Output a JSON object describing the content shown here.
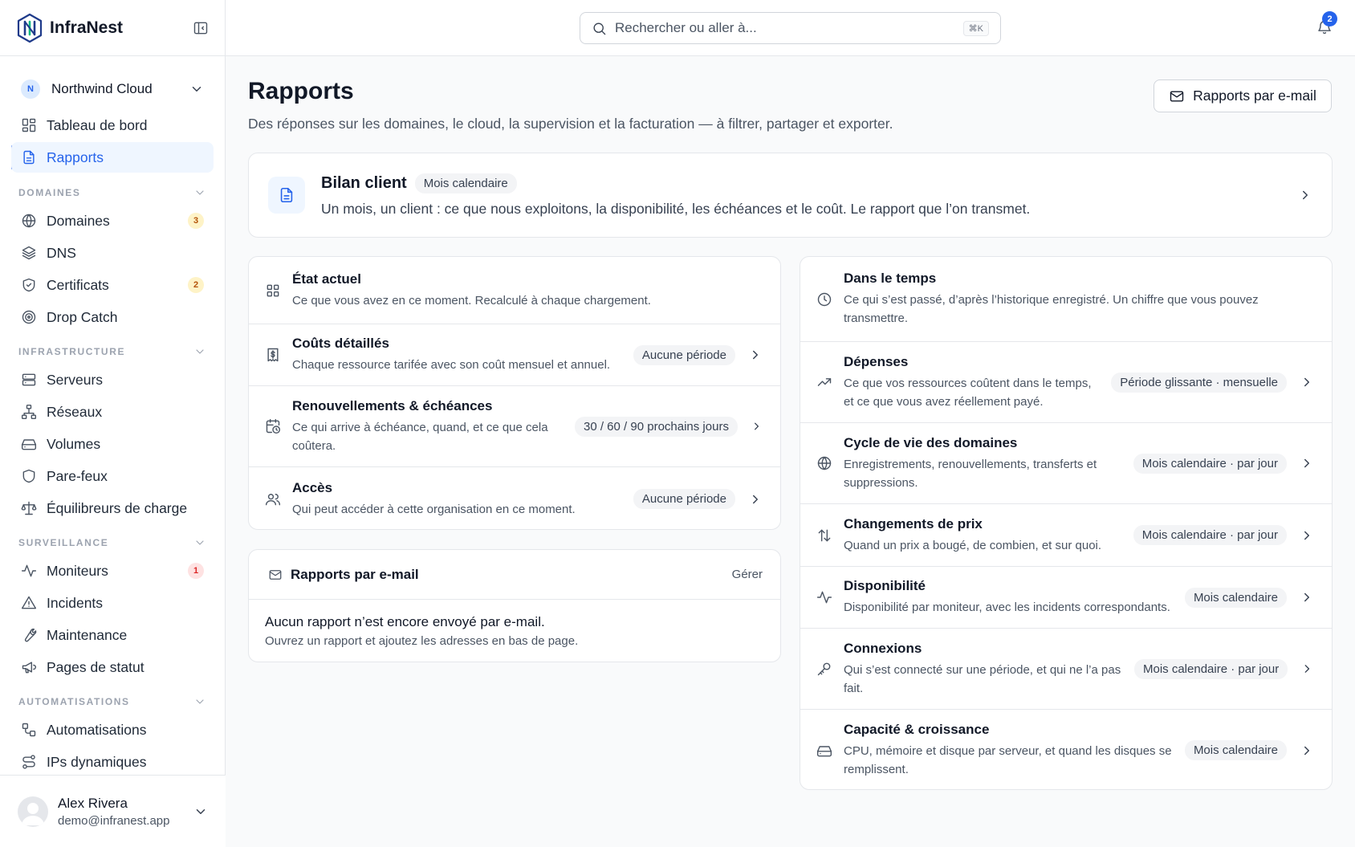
{
  "app": {
    "name": "InfraNest"
  },
  "org": {
    "initial": "N",
    "name": "Northwind Cloud"
  },
  "nav": {
    "dashboard": "Tableau de bord",
    "reports": "Rapports",
    "sections": {
      "domains": "DOMAINES",
      "infrastructure": "INFRASTRUCTURE",
      "monitoring": "SURVEILLANCE",
      "automations": "AUTOMATISATIONS"
    },
    "items": {
      "domains": {
        "label": "Domaines",
        "badge": "3"
      },
      "dns": {
        "label": "DNS"
      },
      "certificates": {
        "label": "Certificats",
        "badge": "2"
      },
      "drop_catch": {
        "label": "Drop Catch"
      },
      "servers": {
        "label": "Serveurs"
      },
      "networks": {
        "label": "Réseaux"
      },
      "volumes": {
        "label": "Volumes"
      },
      "firewalls": {
        "label": "Pare-feux"
      },
      "load_balancers": {
        "label": "Équilibreurs de charge"
      },
      "monitors": {
        "label": "Moniteurs",
        "badge": "1"
      },
      "incidents": {
        "label": "Incidents"
      },
      "maintenance": {
        "label": "Maintenance"
      },
      "status_pages": {
        "label": "Pages de statut"
      },
      "automations": {
        "label": "Automatisations"
      },
      "dynamic_ips": {
        "label": "IPs dynamiques"
      }
    }
  },
  "user": {
    "name": "Alex Rivera",
    "email": "demo@infranest.app"
  },
  "search": {
    "placeholder": "Rechercher ou aller à...",
    "shortcut": "⌘K"
  },
  "notifications": {
    "count": "2"
  },
  "page": {
    "title": "Rapports",
    "subtitle": "Des réponses sur les domaines, le cloud, la supervision et la facturation — à filtrer, partager et exporter.",
    "email_button": "Rapports par e-mail"
  },
  "hero": {
    "title": "Bilan client",
    "pill": "Mois calendaire",
    "desc": "Un mois, un client : ce que nous exploitons, la disponibilité, les échéances et le coût. Le rapport que l’on transmet."
  },
  "current": {
    "header_title": "État actuel",
    "header_desc": "Ce que vous avez en ce moment. Recalculé à chaque chargement.",
    "rows": [
      {
        "title": "Coûts détaillés",
        "desc": "Chaque ressource tarifée avec son coût mensuel et annuel.",
        "pill": "Aucune période"
      },
      {
        "title": "Renouvellements & échéances",
        "desc": "Ce qui arrive à échéance, quand, et ce que cela coûtera.",
        "pill": "30 / 60 / 90 prochains jours"
      },
      {
        "title": "Accès",
        "desc": "Qui peut accéder à cette organisation en ce moment.",
        "pill": "Aucune période"
      }
    ]
  },
  "email_reports": {
    "title": "Rapports par e-mail",
    "manage": "Gérer",
    "empty_title": "Aucun rapport n’est encore envoyé par e-mail.",
    "empty_desc": "Ouvrez un rapport et ajoutez les adresses en bas de page."
  },
  "over_time": {
    "header_title": "Dans le temps",
    "header_desc": "Ce qui s’est passé, d’après l’historique enregistré. Un chiffre que vous pouvez transmettre.",
    "rows": [
      {
        "title": "Dépenses",
        "desc": "Ce que vos ressources coûtent dans le temps, et ce que vous avez réellement payé.",
        "pill": "Période glissante · mensuelle"
      },
      {
        "title": "Cycle de vie des domaines",
        "desc": "Enregistrements, renouvellements, transferts et suppressions.",
        "pill": "Mois calendaire · par jour"
      },
      {
        "title": "Changements de prix",
        "desc": "Quand un prix a bougé, de combien, et sur quoi.",
        "pill": "Mois calendaire · par jour"
      },
      {
        "title": "Disponibilité",
        "desc": "Disponibilité par moniteur, avec les incidents correspondants.",
        "pill": "Mois calendaire"
      },
      {
        "title": "Connexions",
        "desc": "Qui s’est connecté sur une période, et qui ne l’a pas fait.",
        "pill": "Mois calendaire · par jour"
      },
      {
        "title": "Capacité & croissance",
        "desc": "CPU, mémoire et disque par serveur, et quand les disques se remplissent.",
        "pill": "Mois calendaire"
      }
    ]
  }
}
